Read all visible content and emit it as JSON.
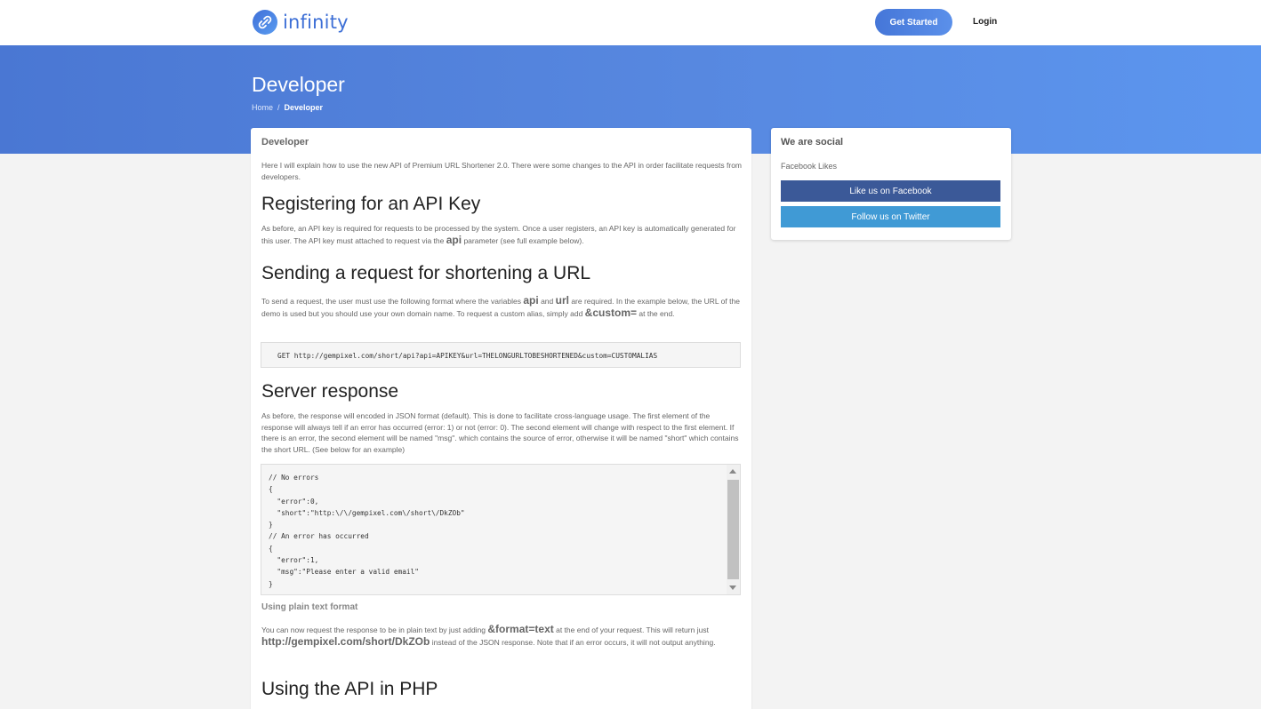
{
  "brand": {
    "name": "infinity",
    "accent": "#3d6fd6"
  },
  "nav": {
    "get_started": "Get Started",
    "login": "Login"
  },
  "hero": {
    "title": "Developer",
    "breadcrumb": {
      "home": "Home",
      "separator": "/",
      "current": "Developer"
    }
  },
  "main": {
    "panel_title": "Developer",
    "intro": "Here I will explain how to use the new API of Premium URL Shortener 2.0. There were some changes to the API in order facilitate requests from developers.",
    "section_api_key": {
      "heading": "Registering for an API Key",
      "text_before": "As before, an API key is required for requests to be processed by the system. Once a user registers, an API key is automatically generated for this user. The API key must attached to request via the ",
      "param": "api",
      "text_after": " parameter (see full example below)."
    },
    "section_request": {
      "heading": "Sending a request for shortening a URL",
      "text_1": "To send a request, the user must use the following format where the variables ",
      "var_api": "api",
      "text_2": " and ",
      "var_url": "url",
      "text_3": " are required. In the example below, the URL of the demo is used but you should use your own domain name. To request a custom alias, simply add ",
      "custom_param": "&custom=",
      "text_4": " at the end.",
      "code": "GET http://gempixel.com/short/api?api=APIKEY&url=THELONGURLTOBESHORTENED&custom=CUSTOMALIAS"
    },
    "section_response": {
      "heading": "Server response",
      "text": "As before, the response will encoded in JSON format (default). This is done to facilitate cross-language usage. The first element of the response will always tell if an error has occurred (error: 1) or not (error: 0). The second element will change with respect to the first element. If there is an error, the second element will be named \"msg\". which contains the source of error, otherwise it will be named \"short\" which contains the short URL. (See below for an example)",
      "code": "// No errors\n{\n  \"error\":0,\n  \"short\":\"http:\\/\\/gempixel.com\\/short\\/DkZOb\"\n}\n// An error has occurred\n{\n  \"error\":1,\n  \"msg\":\"Please enter a valid email\"\n}"
    },
    "section_plain": {
      "heading": "Using plain text format",
      "text_1": "You can now request the response to be in plain text by just adding ",
      "param": "&format=text",
      "text_2": " at the end of your request. This will return just ",
      "example_url": "http://gempixel.com/short/DkZOb",
      "text_3": " instead of the JSON response. Note that if an error occurs, it will not output anything."
    },
    "section_php": {
      "heading": "Using the API in PHP"
    }
  },
  "sidebar": {
    "title": "We are social",
    "facebook_likes": "Facebook Likes",
    "facebook_button": "Like us on Facebook",
    "twitter_button": "Follow us on Twitter",
    "facebook_color": "#3b5998",
    "twitter_color": "#409ad5"
  }
}
